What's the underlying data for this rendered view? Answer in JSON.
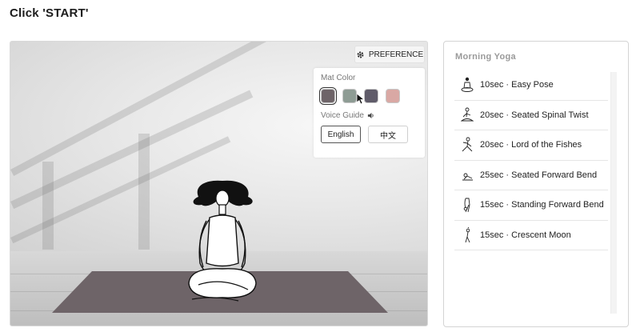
{
  "page": {
    "title": "Click 'START'"
  },
  "preference": {
    "button_label": "PREFERENCE",
    "mat_color_label": "Mat Color",
    "mat_colors": [
      "#6e6468",
      "#8e9c94",
      "#605c6a",
      "#d9a8a4"
    ],
    "selected_mat_color": "#6e6468",
    "voice_guide_label": "Voice Guide",
    "languages": [
      "English",
      "中文"
    ],
    "selected_language": "English"
  },
  "routine": {
    "title": "Morning Yoga",
    "items": [
      {
        "label": "10sec · Easy Pose",
        "icon": "easy-pose-icon"
      },
      {
        "label": "20sec · Seated Spinal Twist",
        "icon": "seated-spinal-twist-icon"
      },
      {
        "label": "20sec · Lord of the Fishes",
        "icon": "lord-of-the-fishes-icon"
      },
      {
        "label": "25sec · Seated Forward Bend",
        "icon": "seated-forward-bend-icon"
      },
      {
        "label": "15sec · Standing Forward Bend",
        "icon": "standing-forward-bend-icon"
      },
      {
        "label": "15sec · Crescent Moon",
        "icon": "crescent-moon-icon"
      }
    ]
  },
  "colors": {
    "mat": "#6e6468",
    "accent": "#222222"
  }
}
